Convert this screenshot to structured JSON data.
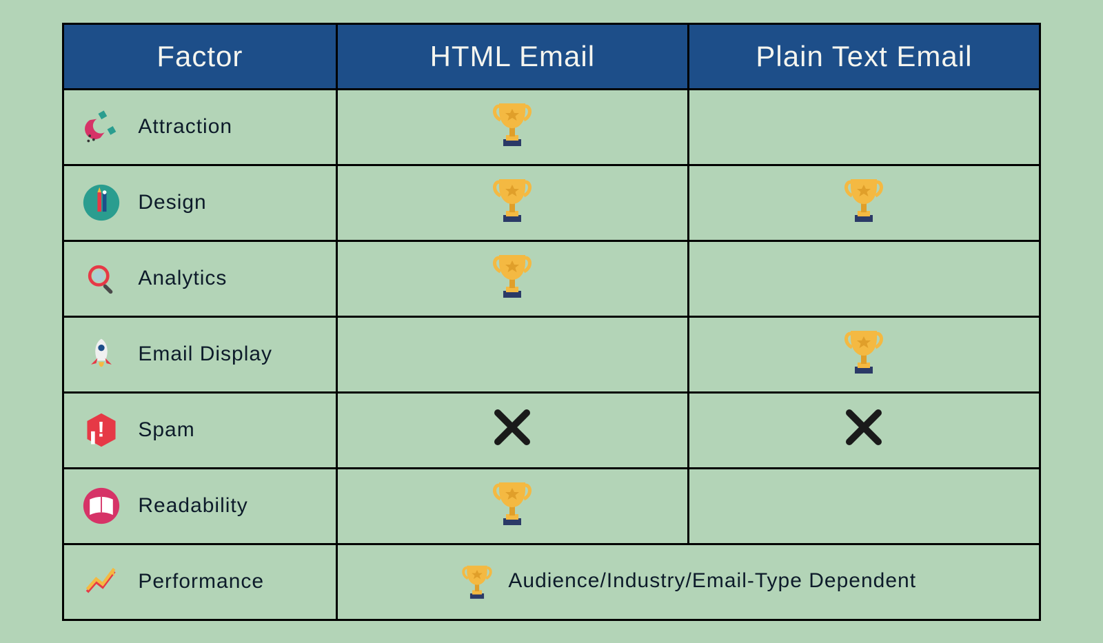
{
  "headers": {
    "factor": "Factor",
    "html_email": "HTML Email",
    "plain_text_email": "Plain Text Email"
  },
  "rows": [
    {
      "factor": "Attraction",
      "icon": "magnet-icon",
      "html": "trophy",
      "plain": ""
    },
    {
      "factor": "Design",
      "icon": "design-icon",
      "html": "trophy",
      "plain": "trophy"
    },
    {
      "factor": "Analytics",
      "icon": "magnifier-icon",
      "html": "trophy",
      "plain": ""
    },
    {
      "factor": "Email Display",
      "icon": "rocket-icon",
      "html": "",
      "plain": "trophy"
    },
    {
      "factor": "Spam",
      "icon": "alert-icon",
      "html": "cross",
      "plain": "cross"
    },
    {
      "factor": "Readability",
      "icon": "book-icon",
      "html": "trophy",
      "plain": ""
    }
  ],
  "performance_row": {
    "factor": "Performance",
    "icon": "chart-icon",
    "merged_text": "Audience/Industry/Email-Type Dependent",
    "merged_mark": "trophy"
  },
  "colors": {
    "header_bg": "#1d4e89",
    "bg": "#b3d4b7",
    "trophy_gold": "#f4b942",
    "trophy_dark": "#e09f2a",
    "base_navy": "#2b3a67",
    "cross": "#1a1a1a"
  }
}
